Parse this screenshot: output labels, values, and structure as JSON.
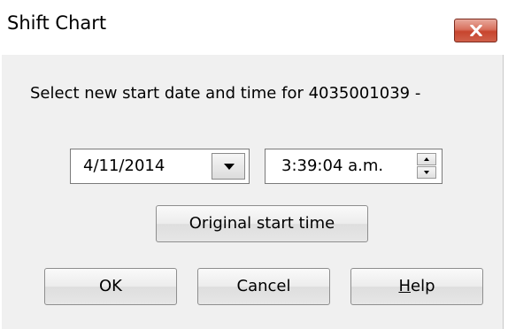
{
  "window": {
    "title": "Shift Chart",
    "close_icon": "close-x-icon",
    "close_color": "#c7452e"
  },
  "prompt": "Select new start date and time for 4035001039 -",
  "date_picker": {
    "value": "4/11/2014",
    "dropdown_icon": "chevron-down-icon"
  },
  "time_picker": {
    "value": "3:39:04 a.m.",
    "spin_up_icon": "spin-up-icon",
    "spin_down_icon": "spin-down-icon"
  },
  "buttons": {
    "original_start_time": "Original start time",
    "ok": "OK",
    "cancel": "Cancel",
    "help_first": "H",
    "help_rest": "elp"
  }
}
